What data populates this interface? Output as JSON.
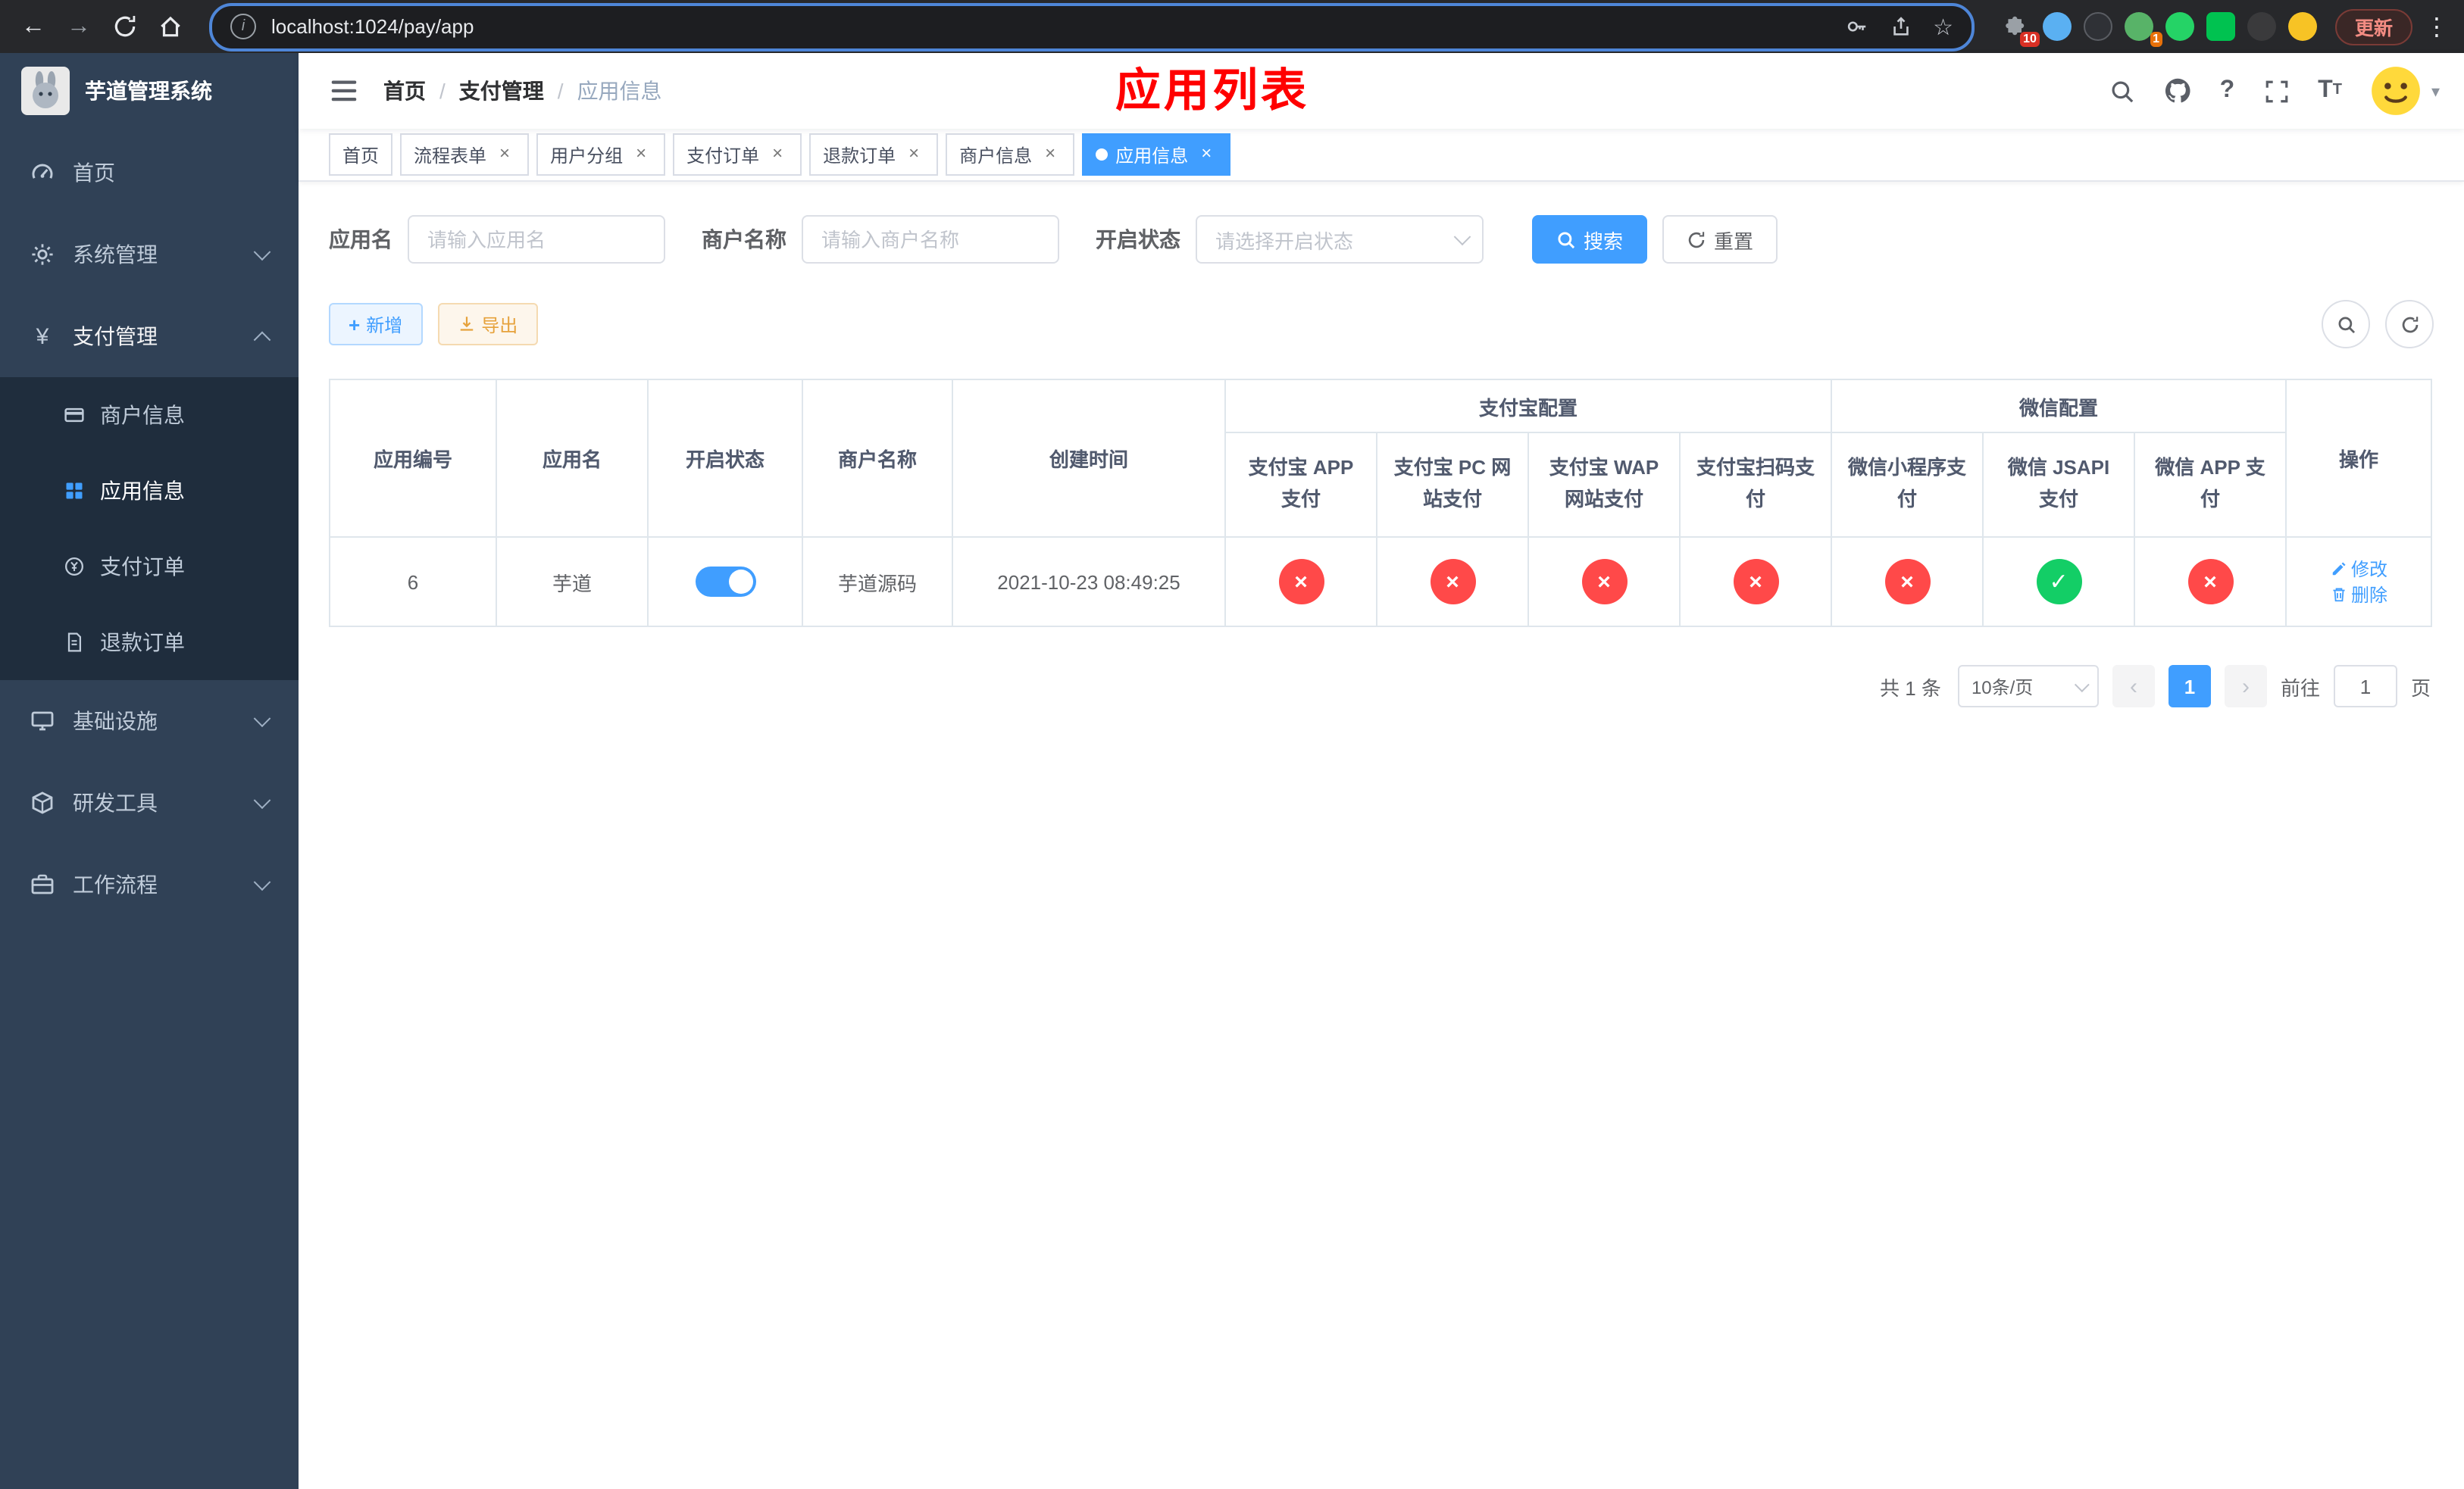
{
  "browser": {
    "url": "localhost:1024/pay/app",
    "update_button": "更新",
    "extensions_badge": "10",
    "extension_badge_2": "1"
  },
  "icons": {
    "back": "←",
    "forward": "→",
    "info": "i",
    "star": "☆",
    "kebab": "⋮",
    "yen": "¥",
    "help": "?",
    "font_size": "T",
    "close": "×",
    "check": "✓",
    "cross": "×",
    "dot": "●",
    "caret_down": "▾",
    "plus": "+",
    "prev": "‹",
    "next": "›"
  },
  "app": {
    "title": "芋道管理系统"
  },
  "sidebar": {
    "items": [
      {
        "label": "首页"
      },
      {
        "label": "系统管理",
        "expandable": true
      },
      {
        "label": "支付管理",
        "expandable": true,
        "expanded": true,
        "children": [
          {
            "label": "商户信息"
          },
          {
            "label": "应用信息",
            "active": true
          },
          {
            "label": "支付订单"
          },
          {
            "label": "退款订单"
          }
        ]
      },
      {
        "label": "基础设施",
        "expandable": true
      },
      {
        "label": "研发工具",
        "expandable": true
      },
      {
        "label": "工作流程",
        "expandable": true
      }
    ]
  },
  "header": {
    "breadcrumb": [
      {
        "label": "首页"
      },
      {
        "label": "支付管理"
      },
      {
        "label": "应用信息"
      }
    ],
    "watermark": "应用列表"
  },
  "tabs": [
    {
      "label": "首页",
      "closable": false,
      "active": false
    },
    {
      "label": "流程表单",
      "closable": true,
      "active": false
    },
    {
      "label": "用户分组",
      "closable": true,
      "active": false
    },
    {
      "label": "支付订单",
      "closable": true,
      "active": false
    },
    {
      "label": "退款订单",
      "closable": true,
      "active": false
    },
    {
      "label": "商户信息",
      "closable": true,
      "active": false
    },
    {
      "label": "应用信息",
      "closable": true,
      "active": true
    }
  ],
  "filters": {
    "app_name": {
      "label": "应用名",
      "placeholder": "请输入应用名",
      "value": ""
    },
    "merchant_name": {
      "label": "商户名称",
      "placeholder": "请输入商户名称",
      "value": ""
    },
    "status": {
      "label": "开启状态",
      "placeholder": "请选择开启状态"
    },
    "search": "搜索",
    "reset": "重置"
  },
  "toolbar": {
    "add": "新增",
    "export": "导出"
  },
  "table": {
    "headers": {
      "app_id": "应用编号",
      "app_name": "应用名",
      "status": "开启状态",
      "merchant_name": "商户名称",
      "create_time": "创建时间",
      "alipay_group": "支付宝配置",
      "wechat_group": "微信配置",
      "alipay_app": "支付宝 APP 支付",
      "alipay_pc": "支付宝 PC 网站支付",
      "alipay_wap": "支付宝 WAP 网站支付",
      "alipay_qr": "支付宝扫码支付",
      "wechat_mini": "微信小程序支付",
      "wechat_jsapi": "微信 JSAPI 支付",
      "wechat_app": "微信 APP 支付",
      "ops": "操作"
    },
    "row": {
      "app_id": "6",
      "app_name": "芋道",
      "status_on": true,
      "merchant_name": "芋道源码",
      "create_time": "2021-10-23 08:49:25",
      "configs": [
        "no",
        "no",
        "no",
        "no",
        "no",
        "yes",
        "no"
      ],
      "edit": "修改",
      "delete": "删除"
    }
  },
  "pagination": {
    "total": "共 1 条",
    "page_size": "10条/页",
    "current_page": "1",
    "goto_label": "前往",
    "goto_value": "1",
    "page_suffix": "页"
  },
  "colors": {
    "accent": "#409EFF",
    "success": "#13ce66",
    "danger": "#ff4949",
    "title_red": "#ff0000",
    "sidebar_bg": "#304156",
    "submenu_bg": "#1f2d3d"
  }
}
